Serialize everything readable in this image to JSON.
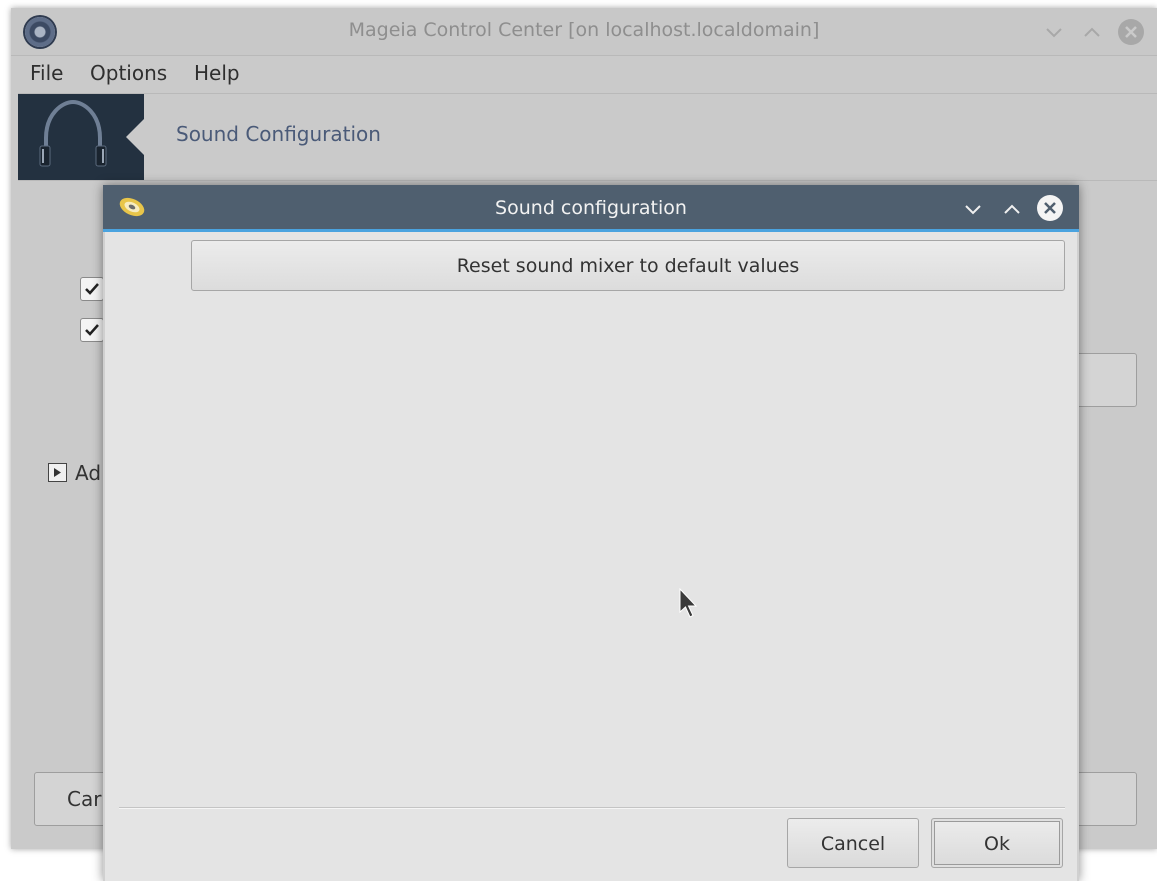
{
  "main_window": {
    "title": "Mageia Control Center [on localhost.localdomain]",
    "menu": [
      "File",
      "Options",
      "Help"
    ],
    "banner_title": "Sound Configuration",
    "partial_expander_label": "Ad",
    "partial_cancel_label": "Car"
  },
  "dialog": {
    "title": "Sound configuration",
    "reset_button": "Reset sound mixer to default values",
    "cancel_button": "Cancel",
    "ok_button": "Ok"
  },
  "colors": {
    "dialog_titlebar": "#4f5f6f",
    "accent": "#4aa3df",
    "banner_icon_bg": "#233140",
    "banner_title": "#4a5a78"
  },
  "icons": {
    "app": "mageia-gear-icon",
    "banner": "headphones-icon",
    "dialog": "speaker-icon"
  }
}
